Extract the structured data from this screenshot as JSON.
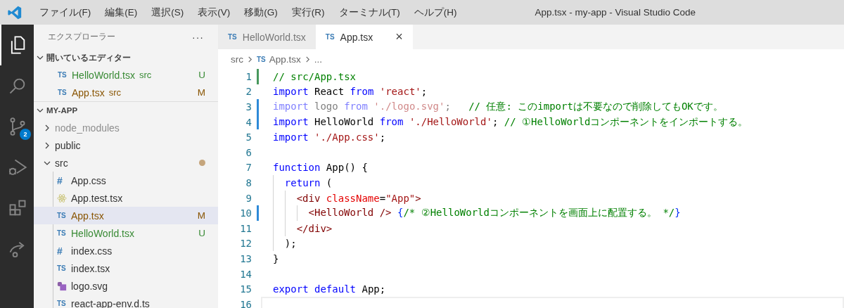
{
  "window": {
    "title": "App.tsx - my-app - Visual Studio Code"
  },
  "menu": [
    "ファイル(F)",
    "編集(E)",
    "選択(S)",
    "表示(V)",
    "移動(G)",
    "実行(R)",
    "ターミナル(T)",
    "ヘルプ(H)"
  ],
  "activity_bar": [
    {
      "kind": "explorer",
      "selected": true
    },
    {
      "kind": "search",
      "selected": false
    },
    {
      "kind": "source-control",
      "selected": false,
      "badge": "2"
    },
    {
      "kind": "run-debug",
      "selected": false
    },
    {
      "kind": "extensions",
      "selected": false
    },
    {
      "kind": "live-share",
      "selected": false
    }
  ],
  "sidebar": {
    "title": "エクスプローラー",
    "more": "···",
    "open_editors": {
      "title": "開いているエディター",
      "expanded": true,
      "items": [
        {
          "icon_text": "TS",
          "name": "HelloWorld.tsx",
          "dir": "src",
          "status": "U",
          "color": "#388a34"
        },
        {
          "icon_text": "TS",
          "name": "App.tsx",
          "dir": "src",
          "status": "M",
          "color": "#895503"
        }
      ]
    },
    "project": {
      "title": "MY-APP",
      "expanded": true,
      "tree": [
        {
          "kind": "folder",
          "name": "node_modules",
          "expanded": false,
          "ignored": true,
          "selected": false
        },
        {
          "kind": "folder",
          "name": "public",
          "expanded": false,
          "ignored": false,
          "selected": false
        },
        {
          "kind": "folder",
          "name": "src",
          "expanded": true,
          "ignored": false,
          "selected": false,
          "color": "#c5a57c",
          "children": [
            {
              "kind": "text",
              "icon_text": "#",
              "name": "App.css",
              "selected": false
            },
            {
              "kind": "react",
              "name": "App.test.tsx",
              "selected": false
            },
            {
              "kind": "text",
              "icon_text": "TS",
              "name": "App.tsx",
              "status": "M",
              "color": "#895503",
              "selected": true
            },
            {
              "kind": "text",
              "icon_text": "TS",
              "name": "HelloWorld.tsx",
              "status": "U",
              "color": "#388a34",
              "selected": false
            },
            {
              "kind": "text",
              "icon_text": "#",
              "name": "index.css",
              "selected": false
            },
            {
              "kind": "text",
              "icon_text": "TS",
              "name": "index.tsx",
              "selected": false
            },
            {
              "kind": "svg",
              "name": "logo.svg",
              "selected": false
            },
            {
              "kind": "text",
              "icon_text": "TS",
              "name": "react-app-env.d.ts",
              "selected": false
            }
          ]
        }
      ]
    }
  },
  "tabs": [
    {
      "icon_text": "TS",
      "label": "HelloWorld.tsx",
      "selected": false
    },
    {
      "icon_text": "TS",
      "label": "App.tsx",
      "selected": true,
      "close": "×"
    }
  ],
  "breadcrumb": {
    "folder": "src",
    "icon_text": "TS",
    "file": "App.tsx",
    "more": "..."
  },
  "editor": {
    "lines": [
      {
        "number": "1",
        "color": "#48985d",
        "current": false,
        "tokens": [
          {
            "kind": "comment",
            "text": "// src/App.tsx"
          }
        ]
      },
      {
        "number": "2",
        "current": false,
        "tokens": [
          {
            "kind": "keyword",
            "text": "import"
          },
          {
            "kind": "plain",
            "text": " React "
          },
          {
            "kind": "keyword",
            "text": "from "
          },
          {
            "kind": "string",
            "text": "'react'"
          },
          {
            "kind": "plain",
            "text": ";"
          }
        ]
      },
      {
        "number": "3",
        "color": "#2e8ad8",
        "current": false,
        "tokens": [
          {
            "kind": "unused-keyword",
            "text": "import"
          },
          {
            "kind": "unused-plain",
            "text": " logo "
          },
          {
            "kind": "unused-keyword",
            "text": "from "
          },
          {
            "kind": "unused-string",
            "text": "'./logo.svg'"
          },
          {
            "kind": "unused-plain",
            "text": ";   "
          },
          {
            "kind": "comment",
            "text": "// 任意: このimportは不要なので削除してもOKです。"
          }
        ]
      },
      {
        "number": "4",
        "color": "#2e8ad8",
        "current": false,
        "tokens": [
          {
            "kind": "keyword",
            "text": "import"
          },
          {
            "kind": "plain",
            "text": " HelloWorld "
          },
          {
            "kind": "keyword",
            "text": "from "
          },
          {
            "kind": "string",
            "text": "'./HelloWorld'"
          },
          {
            "kind": "plain",
            "text": "; "
          },
          {
            "kind": "comment",
            "text": "// ①HelloWorldコンポーネントをインポートする。"
          }
        ]
      },
      {
        "number": "5",
        "current": false,
        "tokens": [
          {
            "kind": "keyword",
            "text": "import "
          },
          {
            "kind": "string",
            "text": "'./App.css'"
          },
          {
            "kind": "plain",
            "text": ";"
          }
        ]
      },
      {
        "number": "6",
        "current": false
      },
      {
        "number": "7",
        "current": false,
        "tokens": [
          {
            "kind": "keyword",
            "text": "function"
          },
          {
            "kind": "plain",
            "text": " App() {"
          }
        ]
      },
      {
        "number": "8",
        "current": false,
        "tokens": [
          {
            "kind": "keyword",
            "text": "  return"
          },
          {
            "kind": "plain",
            "text": " ("
          }
        ]
      },
      {
        "number": "9",
        "current": false,
        "tokens": [
          {
            "kind": "tag",
            "text": "    <div "
          },
          {
            "kind": "attr",
            "text": "className"
          },
          {
            "kind": "plain",
            "text": "="
          },
          {
            "kind": "string",
            "text": "\"App\""
          },
          {
            "kind": "tag",
            "text": ">"
          }
        ]
      },
      {
        "number": "10",
        "color": "#2e8ad8",
        "current": false,
        "tokens": [
          {
            "kind": "tag",
            "text": "      <HelloWorld /> "
          },
          {
            "kind": "brace",
            "text": "{"
          },
          {
            "kind": "comment",
            "text": "/* ②HelloWorldコンポーネントを画面上に配置する。 */"
          },
          {
            "kind": "brace",
            "text": "}"
          }
        ]
      },
      {
        "number": "11",
        "current": false,
        "tokens": [
          {
            "kind": "tag",
            "text": "    </div>"
          }
        ]
      },
      {
        "number": "12",
        "current": false,
        "tokens": [
          {
            "kind": "plain",
            "text": "  );"
          }
        ]
      },
      {
        "number": "13",
        "current": false,
        "tokens": [
          {
            "kind": "plain",
            "text": "}"
          }
        ]
      },
      {
        "number": "14",
        "current": false
      },
      {
        "number": "15",
        "current": false,
        "tokens": [
          {
            "kind": "keyword",
            "text": "export "
          },
          {
            "kind": "keyword",
            "text": "default"
          },
          {
            "kind": "plain",
            "text": " App;"
          }
        ]
      },
      {
        "number": "16",
        "current": true
      }
    ]
  }
}
